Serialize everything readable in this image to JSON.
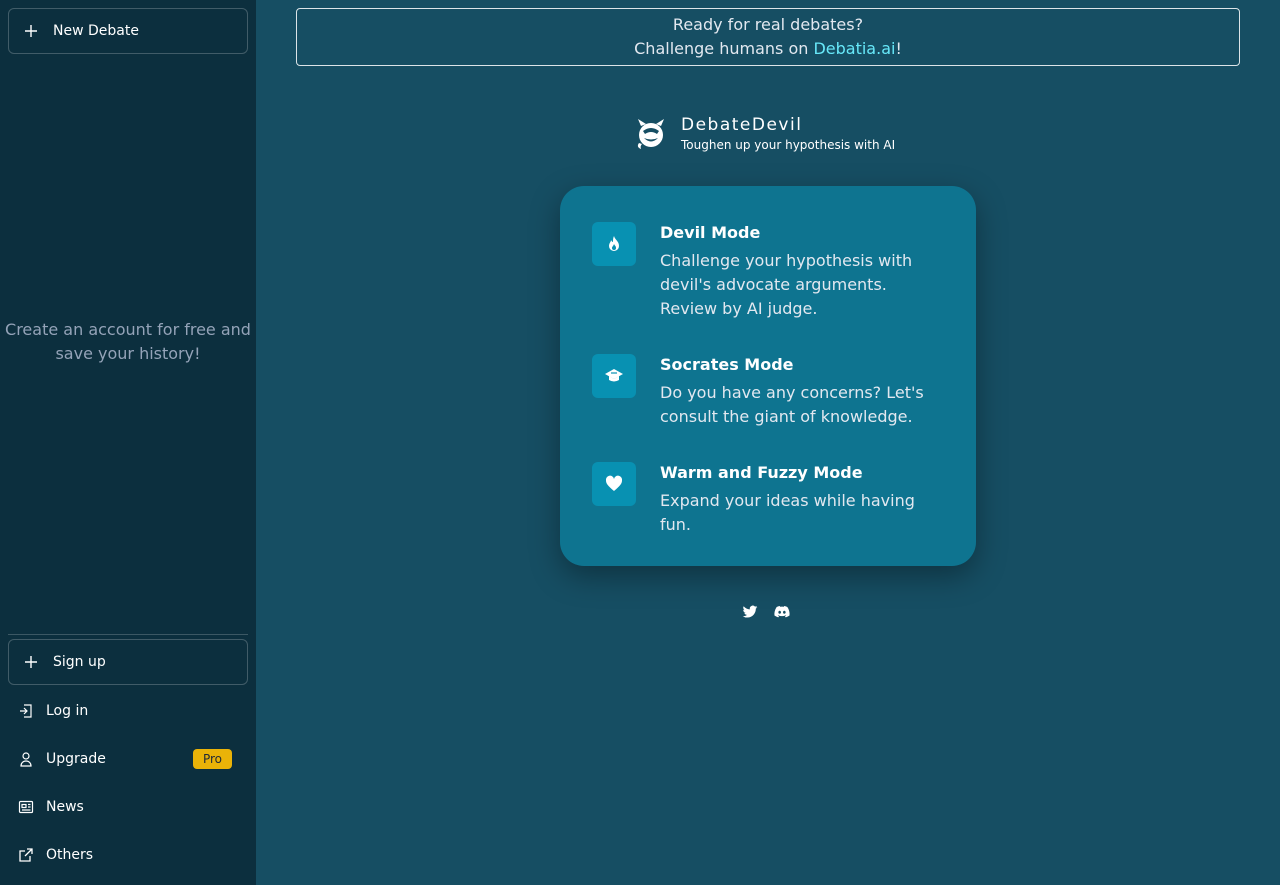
{
  "sidebar": {
    "new_debate_label": "New Debate",
    "account_message": "Create an account for free and save your history!",
    "signup_label": "Sign up",
    "login_label": "Log in",
    "upgrade_label": "Upgrade",
    "pro_badge": "Pro",
    "news_label": "News",
    "others_label": "Others"
  },
  "banner": {
    "line1": "Ready for real debates?",
    "line2_prefix": "Challenge humans on ",
    "link_text": "Debatia.ai",
    "line2_suffix": "!"
  },
  "brand": {
    "name": "DebateDevil",
    "tagline": "Toughen up your hypothesis with AI"
  },
  "modes": [
    {
      "title": "Devil Mode",
      "description": "Challenge your hypothesis with devil's advocate arguments. Review by AI judge.",
      "icon": "flame-icon"
    },
    {
      "title": "Socrates Mode",
      "description": "Do you have any concerns? Let's consult the giant of knowledge.",
      "icon": "graduation-cap-icon"
    },
    {
      "title": "Warm and Fuzzy Mode",
      "description": "Expand your ideas while having fun.",
      "icon": "heart-icon"
    }
  ],
  "socials": [
    "twitter-icon",
    "discord-icon"
  ],
  "colors": {
    "sidebar_bg": "#0c2f3e",
    "main_bg": "#164e63",
    "card_bg": "#0e7490",
    "icon_bg": "#0891b2",
    "link": "#67e8f9",
    "pro_badge": "#eab308"
  }
}
